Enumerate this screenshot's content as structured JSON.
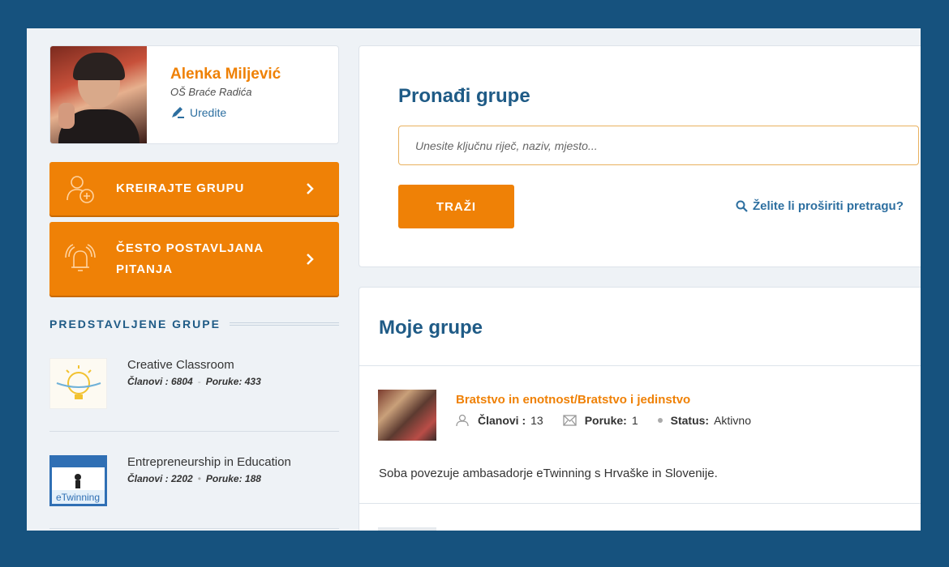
{
  "profile": {
    "name": "Alenka Miljević",
    "school": "OŠ Braće Radića",
    "edit_label": "Uredite"
  },
  "menu": {
    "create_group": "KREIRAJTE GRUPU",
    "faq": "ČESTO POSTAVLJANA PITANJA"
  },
  "featured": {
    "title": "PREDSTAVLJENE GRUPE",
    "groups": [
      {
        "name": "Creative Classroom",
        "members_label": "Članovi : 6804",
        "posts_label": "Poruke: 433"
      },
      {
        "name": "Entrepreneurship in Education",
        "members_label": "Članovi : 2202",
        "posts_label": "Poruke: 188"
      }
    ]
  },
  "search": {
    "title": "Pronađi grupe",
    "placeholder": "Unesite ključnu riječ, naziv, mjesto...",
    "button": "TRAŽI",
    "expand_link": "Želite li proširiti pretragu?"
  },
  "my_groups": {
    "title": "Moje grupe",
    "items": [
      {
        "name": "Bratstvo in enotnost/Bratstvo i jedinstvo",
        "members_key": "Članovi :",
        "members_value": "13",
        "posts_key": "Poruke:",
        "posts_value": "1",
        "status_key": "Status:",
        "status_value": "Aktivno",
        "description": "Soba povezuje ambasadorje eTwinning s Hrvaške in Slovenije."
      }
    ]
  },
  "colors": {
    "frame": "#16527e",
    "accent": "#ef8106",
    "heading": "#1f5b86",
    "link": "#2d6fa0"
  },
  "icons": [
    "edit-pencil-icon",
    "add-user-icon",
    "bell-icon",
    "chevron-right-icon",
    "search-icon",
    "user-icon",
    "envelope-icon"
  ]
}
